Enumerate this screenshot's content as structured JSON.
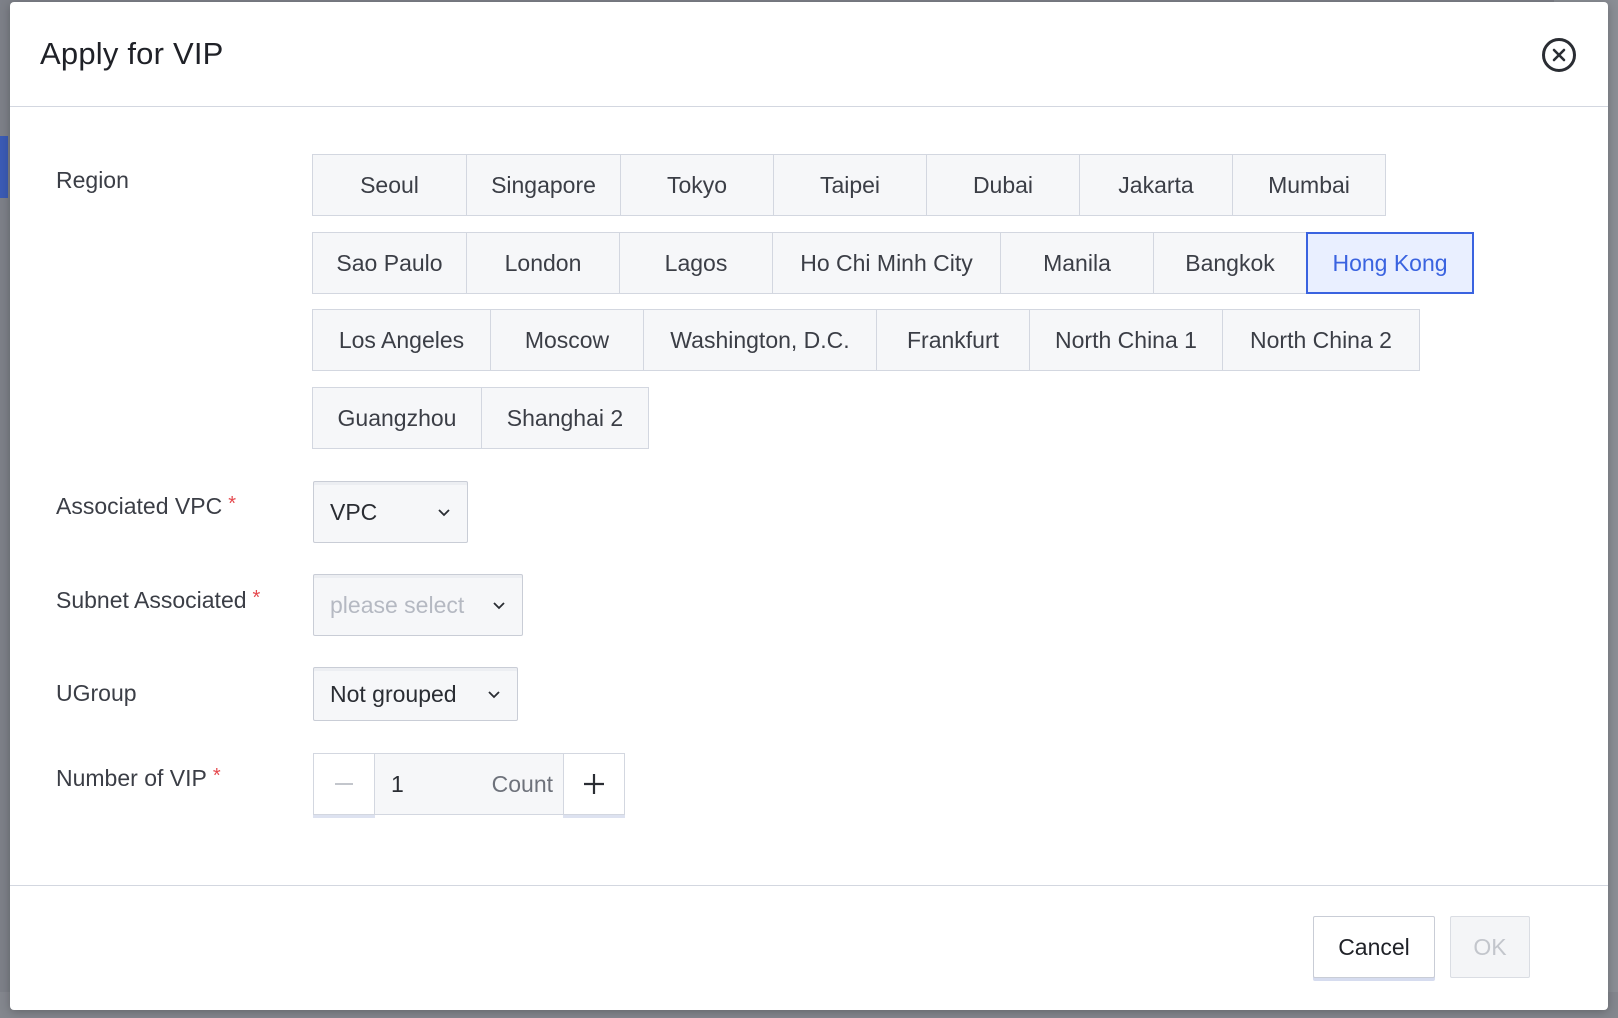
{
  "dialog": {
    "title": "Apply for VIP",
    "close_icon": "close-circle-icon"
  },
  "form": {
    "region": {
      "label": "Region",
      "rows": [
        [
          "Seoul",
          "Singapore",
          "Tokyo",
          "Taipei",
          "Dubai",
          "Jakarta",
          "Mumbai"
        ],
        [
          "Sao Paulo",
          "London",
          "Lagos",
          "Ho Chi Minh City",
          "Manila",
          "Bangkok",
          "Hong Kong"
        ],
        [
          "Los Angeles",
          "Moscow",
          "Washington, D.C.",
          "Frankfurt",
          "North China 1",
          "North China 2"
        ],
        [
          "Guangzhou",
          "Shanghai 2"
        ]
      ],
      "selected": "Hong Kong"
    },
    "vpc": {
      "label": "Associated VPC",
      "required_mark": "*",
      "value": "VPC"
    },
    "subnet": {
      "label": "Subnet Associated",
      "required_mark": "*",
      "placeholder": "please select"
    },
    "ugroup": {
      "label": "UGroup",
      "value": "Not grouped"
    },
    "vip_count": {
      "label": "Number of VIP",
      "required_mark": "*",
      "value": "1",
      "unit": "Count",
      "decrement_icon": "minus-icon",
      "increment_icon": "plus-icon"
    }
  },
  "footer": {
    "cancel_label": "Cancel",
    "ok_label": "OK"
  },
  "colors": {
    "accent": "#3a63e0",
    "required": "#e5484d"
  }
}
